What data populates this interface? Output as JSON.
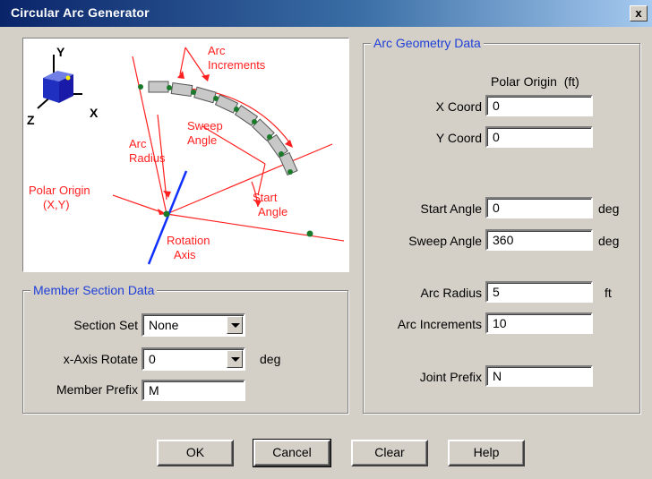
{
  "window": {
    "title": "Circular Arc Generator",
    "close_label": "x"
  },
  "diagram": {
    "axis_y": "Y",
    "axis_x": "X",
    "axis_z": "Z",
    "arc_increments": [
      "Arc",
      "Increments"
    ],
    "sweep_angle": [
      "Sweep",
      "Angle"
    ],
    "arc_radius": [
      "Arc",
      "Radius"
    ],
    "polar_origin": [
      "Polar Origin",
      "(X,Y)"
    ],
    "start_angle": [
      "Start",
      "Angle"
    ],
    "rotation_axis": [
      "Rotation",
      "Axis"
    ]
  },
  "member_section": {
    "title": "Member Section Data",
    "section_set_label": "Section Set",
    "section_set_value": "None",
    "x_axis_rotate_label": "x-Axis Rotate",
    "x_axis_rotate_value": "0",
    "x_axis_rotate_unit": "deg",
    "member_prefix_label": "Member Prefix",
    "member_prefix_value": "M"
  },
  "arc_geometry": {
    "title": "Arc Geometry Data",
    "polar_origin_header": "Polar Origin  (ft)",
    "x_coord_label": "X Coord",
    "x_coord_value": "0",
    "y_coord_label": "Y Coord",
    "y_coord_value": "0",
    "start_angle_label": "Start Angle",
    "start_angle_value": "0",
    "start_angle_unit": "deg",
    "sweep_angle_label": "Sweep Angle",
    "sweep_angle_value": "360",
    "sweep_angle_unit": "deg",
    "arc_radius_label": "Arc Radius",
    "arc_radius_value": "5",
    "arc_radius_unit": "ft",
    "arc_increments_label": "Arc Increments",
    "arc_increments_value": "10",
    "joint_prefix_label": "Joint Prefix",
    "joint_prefix_value": "N"
  },
  "buttons": {
    "ok": "OK",
    "cancel": "Cancel",
    "clear": "Clear",
    "help": "Help"
  }
}
